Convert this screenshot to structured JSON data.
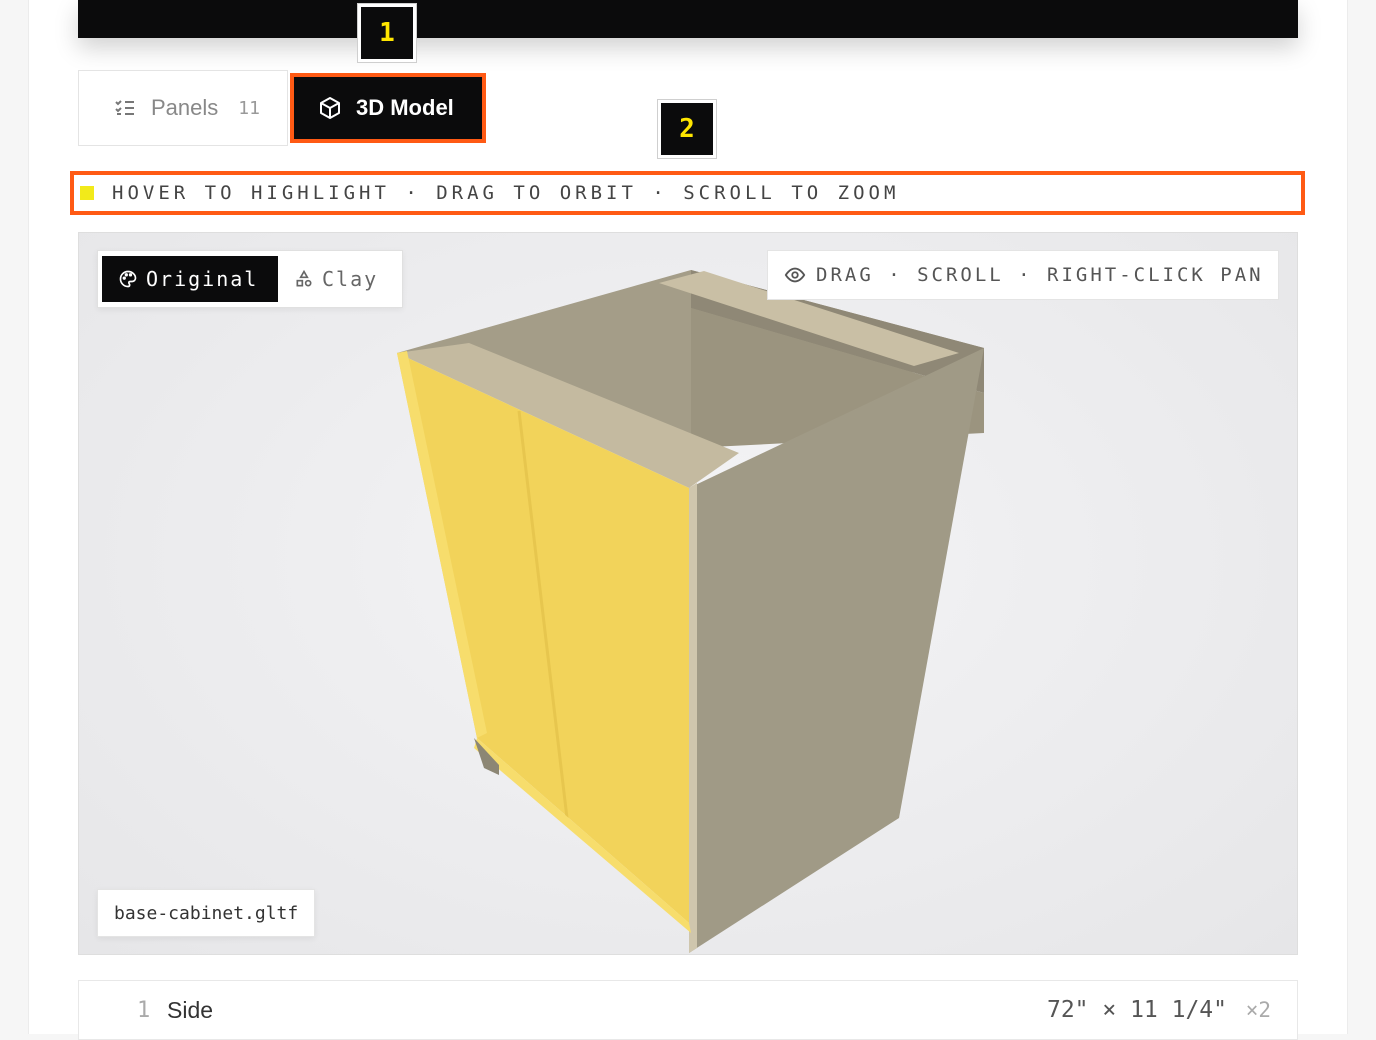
{
  "tabs": {
    "panels_label": "Panels",
    "panels_count": "11",
    "model_label": "3D Model"
  },
  "badges": [
    "1",
    "2"
  ],
  "hint": {
    "text": "HOVER TO HIGHLIGHT · DRAG TO ORBIT · SCROLL TO ZOOM"
  },
  "viewer": {
    "mode_original": "Original",
    "mode_clay": "Clay",
    "controls_hint": "DRAG · SCROLL · RIGHT-CLICK PAN",
    "file_name": "base-cabinet.gltf"
  },
  "panel_list": {
    "rows": [
      {
        "index": "1",
        "name": "Side",
        "dims": "72\" × 11 1/4\"",
        "qty": "×2"
      }
    ]
  },
  "colors": {
    "accent_outline": "#ff5a14",
    "highlight_yellow": "#f2d35a",
    "badge_text": "#ffe600",
    "cabinet_body": "#a09a86"
  }
}
